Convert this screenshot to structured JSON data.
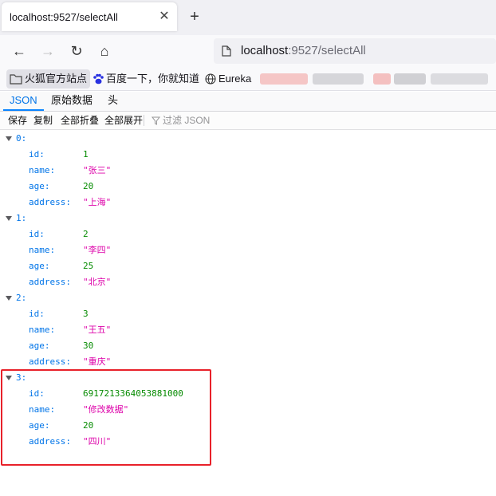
{
  "tab": {
    "title": "localhost:9527/selectAll",
    "close": "✕",
    "new": "+"
  },
  "nav": {
    "back": "←",
    "forward": "→",
    "reload": "↻",
    "home": "⌂"
  },
  "url": {
    "host": "localhost",
    "rest": ":9527/selectAll"
  },
  "bookmarks": [
    {
      "label": "火狐官方站点",
      "icon": "folder-icon"
    },
    {
      "label": "百度一下，你就知道",
      "icon": "baidu-paw-icon"
    },
    {
      "label": "Eureka",
      "icon": "globe-icon"
    }
  ],
  "viewer_tabs": [
    "JSON",
    "原始数据",
    "头"
  ],
  "toolbar": {
    "save": "保存",
    "copy": "复制",
    "collapse_all": "全部折叠",
    "expand_all": "全部展开",
    "filter_placeholder": "过滤 JSON"
  },
  "records": [
    {
      "index": "0:",
      "fields": [
        {
          "key": "id:",
          "value": "1",
          "type": "num"
        },
        {
          "key": "name:",
          "value": "\"张三\"",
          "type": "str"
        },
        {
          "key": "age:",
          "value": "20",
          "type": "num"
        },
        {
          "key": "address:",
          "value": "\"上海\"",
          "type": "str"
        }
      ]
    },
    {
      "index": "1:",
      "fields": [
        {
          "key": "id:",
          "value": "2",
          "type": "num"
        },
        {
          "key": "name:",
          "value": "\"李四\"",
          "type": "str"
        },
        {
          "key": "age:",
          "value": "25",
          "type": "num"
        },
        {
          "key": "address:",
          "value": "\"北京\"",
          "type": "str"
        }
      ]
    },
    {
      "index": "2:",
      "fields": [
        {
          "key": "id:",
          "value": "3",
          "type": "num"
        },
        {
          "key": "name:",
          "value": "\"王五\"",
          "type": "str"
        },
        {
          "key": "age:",
          "value": "30",
          "type": "num"
        },
        {
          "key": "address:",
          "value": "\"重庆\"",
          "type": "str"
        }
      ]
    },
    {
      "index": "3:",
      "fields": [
        {
          "key": "id:",
          "value": "6917213364053881000",
          "type": "num"
        },
        {
          "key": "name:",
          "value": "\"修改数据\"",
          "type": "str"
        },
        {
          "key": "age:",
          "value": "20",
          "type": "num"
        },
        {
          "key": "address:",
          "value": "\"四川\"",
          "type": "str"
        }
      ]
    }
  ],
  "colors": {
    "accent": "#0a84ff",
    "key": "#0074e8",
    "number": "#058b00",
    "string": "#dd00a9",
    "highlight": "#e8212a"
  }
}
